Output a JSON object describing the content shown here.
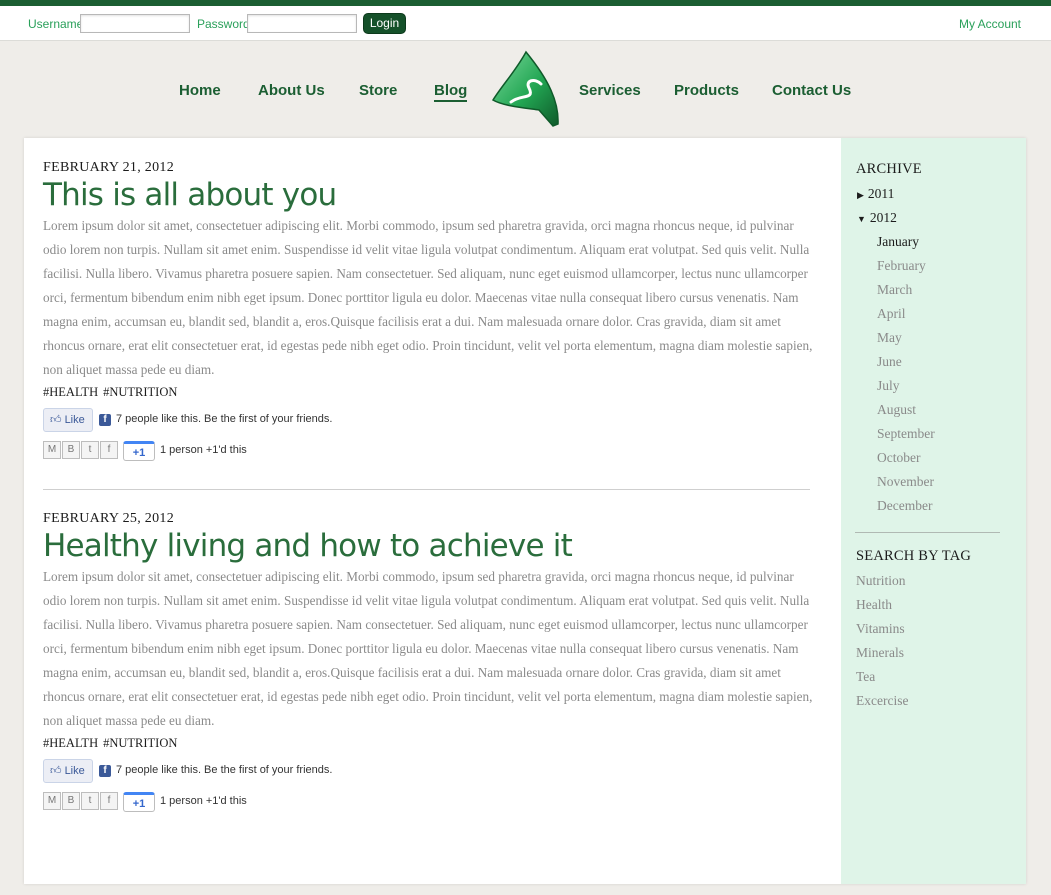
{
  "login": {
    "username_label": "Username",
    "password_label": "Password",
    "username_value": "",
    "password_value": "",
    "button_label": "Login",
    "my_account": "My Account"
  },
  "nav": {
    "home": "Home",
    "about": "About Us",
    "store": "Store",
    "blog": "Blog",
    "services": "Services",
    "products": "Products",
    "contact": "Contact Us"
  },
  "posts": [
    {
      "date": "FEBRUARY 21, 2012",
      "title": "This is all about you",
      "body": "Lorem ipsum dolor sit amet, consectetuer adipiscing elit. Morbi commodo, ipsum sed pharetra gravida, orci magna rhoncus neque, id pulvinar odio lorem non turpis. Nullam sit amet enim. Suspendisse id velit vitae ligula volutpat condimentum. Aliquam erat volutpat. Sed quis velit. Nulla facilisi. Nulla libero. Vivamus pharetra posuere sapien. Nam consectetuer. Sed aliquam, nunc eget euismod ullamcorper, lectus nunc ullamcorper orci, fermentum bibendum enim nibh eget ipsum. Donec porttitor ligula eu dolor. Maecenas vitae nulla consequat libero cursus venenatis. Nam magna enim, accumsan eu, blandit sed, blandit a, eros.Quisque facilisis erat a dui. Nam malesuada ornare dolor. Cras gravida, diam sit amet rhoncus ornare, erat elit consectetuer erat, id egestas pede nibh eget odio. Proin tincidunt, velit vel porta elementum, magna diam molestie sapien, non aliquet massa pede eu diam.",
      "tags": [
        "#HEALTH",
        "#NUTRITION"
      ],
      "like_label": "Like",
      "like_text": "7 people like this. Be the first of your friends.",
      "plusone_label": "+1",
      "plusone_text": "1 person +1'd this"
    },
    {
      "date": "FEBRUARY 25, 2012",
      "title": "Healthy living and how to achieve it",
      "body": "Lorem ipsum dolor sit amet, consectetuer adipiscing elit. Morbi commodo, ipsum sed pharetra gravida, orci magna rhoncus neque, id pulvinar odio lorem non turpis. Nullam sit amet enim. Suspendisse id velit vitae ligula volutpat condimentum. Aliquam erat volutpat. Sed quis velit. Nulla facilisi. Nulla libero. Vivamus pharetra posuere sapien. Nam consectetuer. Sed aliquam, nunc eget euismod ullamcorper, lectus nunc ullamcorper orci, fermentum bibendum enim nibh eget ipsum. Donec porttitor ligula eu dolor. Maecenas vitae nulla consequat libero cursus venenatis. Nam magna enim, accumsan eu, blandit sed, blandit a, eros.Quisque facilisis erat a dui. Nam malesuada ornare dolor. Cras gravida, diam sit amet rhoncus ornare, erat elit consectetuer erat, id egestas pede nibh eget odio. Proin tincidunt, velit vel porta elementum, magna diam molestie sapien, non aliquet massa pede eu diam.",
      "tags": [
        "#HEALTH",
        "#NUTRITION"
      ],
      "like_label": "Like",
      "like_text": "7 people like this. Be the first of your friends.",
      "plusone_label": "+1",
      "plusone_text": "1 person +1'd this"
    }
  ],
  "sidebar": {
    "archive_heading": "ARCHIVE",
    "years": [
      {
        "label": "2011",
        "expanded": false
      },
      {
        "label": "2012",
        "expanded": true
      }
    ],
    "months": [
      "January",
      "February",
      "March",
      "April",
      "May",
      "June",
      "July",
      "August",
      "September",
      "October",
      "November",
      "December"
    ],
    "current_month": "January",
    "tag_heading": "SEARCH BY TAG",
    "tags": [
      "Nutrition",
      "Health",
      "Vitamins",
      "Minerals",
      "Tea",
      "Excercise"
    ]
  },
  "colors": {
    "brand_green": "#1b5e32",
    "title_green": "#2a6d3c",
    "link_green": "#2aa05a",
    "sidebar_bg": "#dff4e8"
  },
  "icons": {
    "share": [
      "gmail-icon",
      "blogger-icon",
      "twitter-icon",
      "facebook-icon"
    ],
    "logo": "leaf-logo"
  }
}
